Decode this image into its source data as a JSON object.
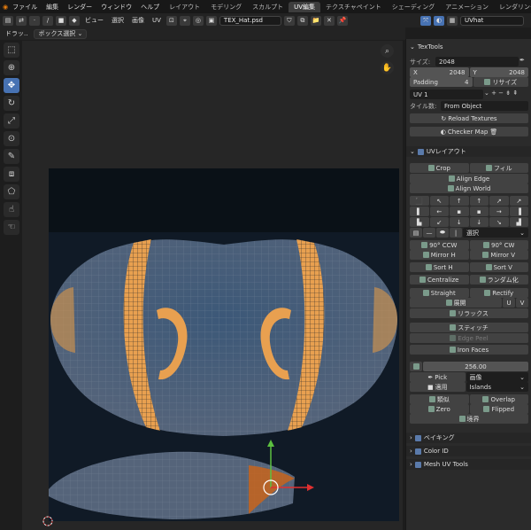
{
  "menubar": {
    "menus": [
      "ファイル",
      "編集",
      "レンダー",
      "ウィンドウ",
      "ヘルプ"
    ],
    "tabs": [
      "レイアウト",
      "モデリング",
      "スカルプト",
      "UV編集",
      "テクスチャペイント",
      "シェーディング",
      "アニメーション",
      "レンダリング",
      "コ"
    ],
    "active_tab": "UV編集"
  },
  "header": {
    "menus": [
      "ビュー",
      "選択",
      "画像",
      "UV"
    ],
    "image_name": "TEX_Hat.psd",
    "uvmap_name": "UVhat"
  },
  "header2": {
    "drag_label": "ドラッ..",
    "select_mode": "ボックス選択"
  },
  "toolbar": {
    "tools": [
      "select-box",
      "cursor",
      "move",
      "rotate",
      "scale",
      "transform",
      "annotate",
      "grab",
      "rip",
      "relax",
      "pinch",
      "sculpt"
    ]
  },
  "panel": {
    "textools": {
      "title": "TexTools",
      "size_label": "サイズ:",
      "size_value": "2048",
      "x_label": "X",
      "x_value": "2048",
      "y_label": "Y",
      "y_value": "2048",
      "padding_label": "Padding",
      "padding_value": "4",
      "resize_label": "リサイズ",
      "uv_channel": "UV 1",
      "tile_label": "タイル数:",
      "tile_value": "From Object",
      "reload": "Reload Textures",
      "checker": "Checker Map"
    },
    "uvlayout": {
      "title": "UVレイアウト",
      "crop": "Crop",
      "fill": "フィル",
      "align_edge": "Align Edge",
      "align_world": "Align World",
      "select_dd": "選択",
      "rot_ccw": "90° CCW",
      "rot_cw": "90° CW",
      "mirror_h": "Mirror H",
      "mirror_v": "Mirror V",
      "sort_h": "Sort H",
      "sort_v": "Sort V",
      "centralize": "Centralize",
      "random": "ランダム化",
      "straight": "Straight",
      "rectify": "Rectify",
      "unwrap": "展開",
      "unwrap_u": "U",
      "unwrap_v": "V",
      "relax": "リラックス",
      "stitch": "スティッチ",
      "edge_peel": "Edge Peel",
      "iron_faces": "Iron Faces",
      "value": "256.00",
      "pick": "Pick",
      "pick_dd": "画像",
      "apply": "適用",
      "apply_dd": "Islands",
      "similar": "類似",
      "overlap": "Overlap",
      "zero": "Zero",
      "flipped": "Flipped",
      "boundary": "境界"
    },
    "collapsed": [
      "ベイキング",
      "Color ID",
      "Mesh UV Tools"
    ]
  },
  "colors": {
    "accent": "#4772b3",
    "orange": "#e8a050",
    "uv_fill": "#4a5a70",
    "gizmo_y": "#5cc040",
    "gizmo_x": "#e03030"
  }
}
